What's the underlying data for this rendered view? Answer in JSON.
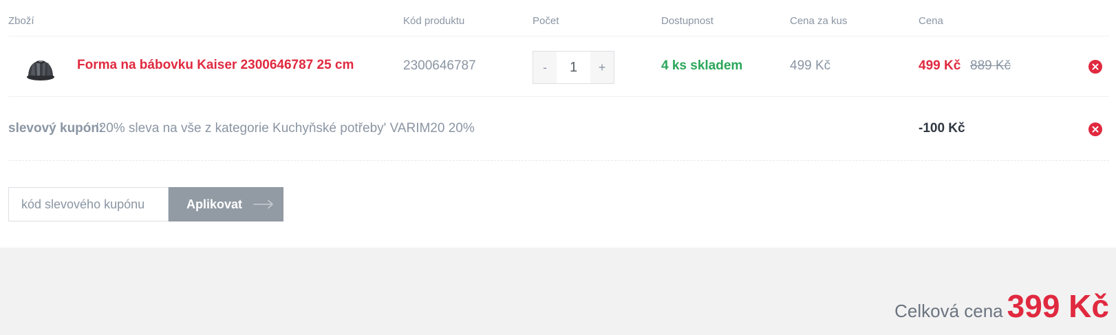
{
  "columns": {
    "item": "Zboží",
    "code": "Kód produktu",
    "count": "Počet",
    "availability": "Dostupnost",
    "unit_price": "Cena za kus",
    "price": "Cena"
  },
  "product": {
    "name": "Forma na bábovku Kaiser 2300646787 25 cm",
    "code": "2300646787",
    "quantity": "1",
    "minus": "-",
    "plus": "+",
    "availability": "4 ks skladem",
    "unit_price": "499 Kč",
    "price": "499 Kč",
    "old_price": "889 Kč",
    "image_icon": "bundt-pan-image"
  },
  "coupon": {
    "label": "slevový kupón:",
    "text": "'20% sleva na vše z kategorie Kuchyňské potřeby' VARIM20 20%",
    "discount": "-100 Kč"
  },
  "coupon_form": {
    "placeholder": "kód slevového kupónu",
    "value": "",
    "apply_label": "Aplikovat",
    "apply_icon": "arrow-right-icon"
  },
  "summary": {
    "total_label": "Celková cena",
    "total_value": "399 Kč"
  },
  "colors": {
    "accent_red": "#e0293f",
    "stock_green": "#2aa65a",
    "muted_text": "#8a95a3",
    "button_gray": "#929aa3",
    "footer_bg": "#f2f2f2"
  },
  "icons": {
    "remove": "close-circle-icon"
  }
}
